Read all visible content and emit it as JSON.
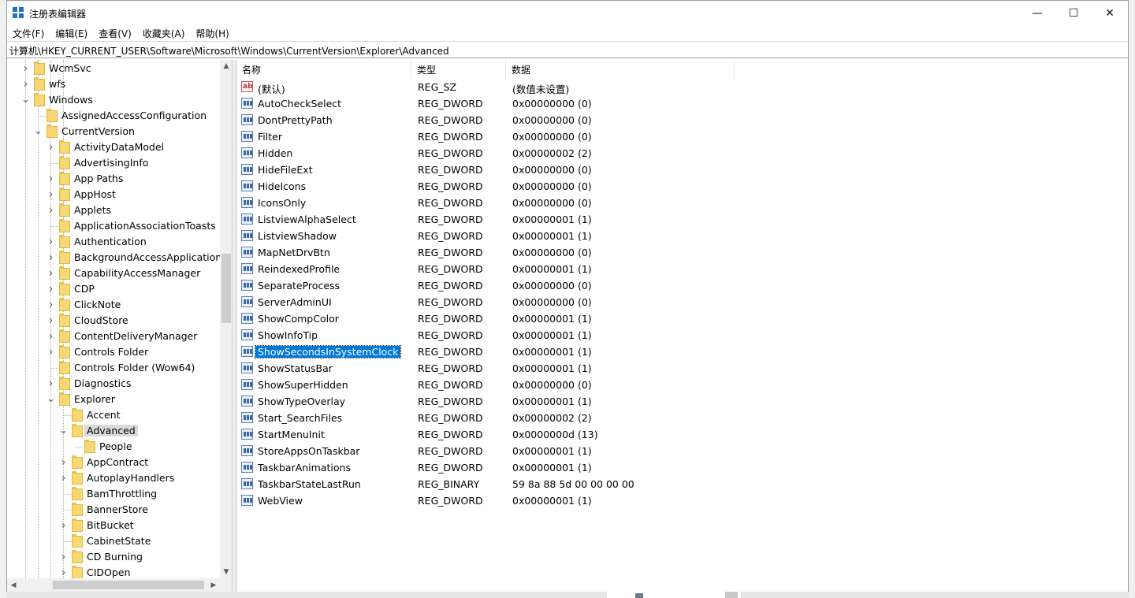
{
  "window": {
    "title": "注册表编辑器",
    "minimize_glyph": "—",
    "maximize_glyph": "☐",
    "close_glyph": "✕"
  },
  "menu": [
    {
      "label": "文件(F)",
      "name": "menu-file"
    },
    {
      "label": "编辑(E)",
      "name": "menu-edit"
    },
    {
      "label": "查看(V)",
      "name": "menu-view"
    },
    {
      "label": "收藏夹(A)",
      "name": "menu-favorites"
    },
    {
      "label": "帮助(H)",
      "name": "menu-help"
    }
  ],
  "address": "计算机\\HKEY_CURRENT_USER\\Software\\Microsoft\\Windows\\CurrentVersion\\Explorer\\Advanced",
  "tree": [
    {
      "label": "WcmSvc",
      "level": 0,
      "expander": "collapsed"
    },
    {
      "label": "wfs",
      "level": 0,
      "expander": "collapsed"
    },
    {
      "label": "Windows",
      "level": 0,
      "expander": "expanded"
    },
    {
      "label": "AssignedAccessConfiguration",
      "level": 1,
      "expander": "none"
    },
    {
      "label": "CurrentVersion",
      "level": 1,
      "expander": "expanded"
    },
    {
      "label": "ActivityDataModel",
      "level": 2,
      "expander": "collapsed"
    },
    {
      "label": "AdvertisingInfo",
      "level": 2,
      "expander": "none"
    },
    {
      "label": "App Paths",
      "level": 2,
      "expander": "collapsed"
    },
    {
      "label": "AppHost",
      "level": 2,
      "expander": "collapsed"
    },
    {
      "label": "Applets",
      "level": 2,
      "expander": "collapsed"
    },
    {
      "label": "ApplicationAssociationToasts",
      "level": 2,
      "expander": "none"
    },
    {
      "label": "Authentication",
      "level": 2,
      "expander": "collapsed"
    },
    {
      "label": "BackgroundAccessApplications",
      "level": 2,
      "expander": "collapsed"
    },
    {
      "label": "CapabilityAccessManager",
      "level": 2,
      "expander": "collapsed"
    },
    {
      "label": "CDP",
      "level": 2,
      "expander": "collapsed"
    },
    {
      "label": "ClickNote",
      "level": 2,
      "expander": "collapsed"
    },
    {
      "label": "CloudStore",
      "level": 2,
      "expander": "collapsed"
    },
    {
      "label": "ContentDeliveryManager",
      "level": 2,
      "expander": "collapsed"
    },
    {
      "label": "Controls Folder",
      "level": 2,
      "expander": "collapsed"
    },
    {
      "label": "Controls Folder (Wow64)",
      "level": 2,
      "expander": "none"
    },
    {
      "label": "Diagnostics",
      "level": 2,
      "expander": "collapsed"
    },
    {
      "label": "Explorer",
      "level": 2,
      "expander": "expanded"
    },
    {
      "label": "Accent",
      "level": 3,
      "expander": "none"
    },
    {
      "label": "Advanced",
      "level": 3,
      "expander": "expanded",
      "selected": true
    },
    {
      "label": "People",
      "level": 4,
      "expander": "none"
    },
    {
      "label": "AppContract",
      "level": 3,
      "expander": "collapsed"
    },
    {
      "label": "AutoplayHandlers",
      "level": 3,
      "expander": "collapsed"
    },
    {
      "label": "BamThrottling",
      "level": 3,
      "expander": "none"
    },
    {
      "label": "BannerStore",
      "level": 3,
      "expander": "none"
    },
    {
      "label": "BitBucket",
      "level": 3,
      "expander": "collapsed"
    },
    {
      "label": "CabinetState",
      "level": 3,
      "expander": "none"
    },
    {
      "label": "CD Burning",
      "level": 3,
      "expander": "collapsed"
    },
    {
      "label": "CIDOpen",
      "level": 3,
      "expander": "collapsed"
    }
  ],
  "columns": {
    "name": "名称",
    "type": "类型",
    "data": "数据"
  },
  "values": [
    {
      "name": "(默认)",
      "type": "REG_SZ",
      "data": "(数值未设置)",
      "icon": "string-value-icon"
    },
    {
      "name": "AutoCheckSelect",
      "type": "REG_DWORD",
      "data": "0x00000000 (0)",
      "icon": "binary-value-icon"
    },
    {
      "name": "DontPrettyPath",
      "type": "REG_DWORD",
      "data": "0x00000000 (0)",
      "icon": "binary-value-icon"
    },
    {
      "name": "Filter",
      "type": "REG_DWORD",
      "data": "0x00000000 (0)",
      "icon": "binary-value-icon"
    },
    {
      "name": "Hidden",
      "type": "REG_DWORD",
      "data": "0x00000002 (2)",
      "icon": "binary-value-icon"
    },
    {
      "name": "HideFileExt",
      "type": "REG_DWORD",
      "data": "0x00000000 (0)",
      "icon": "binary-value-icon"
    },
    {
      "name": "HideIcons",
      "type": "REG_DWORD",
      "data": "0x00000000 (0)",
      "icon": "binary-value-icon"
    },
    {
      "name": "IconsOnly",
      "type": "REG_DWORD",
      "data": "0x00000000 (0)",
      "icon": "binary-value-icon"
    },
    {
      "name": "ListviewAlphaSelect",
      "type": "REG_DWORD",
      "data": "0x00000001 (1)",
      "icon": "binary-value-icon"
    },
    {
      "name": "ListviewShadow",
      "type": "REG_DWORD",
      "data": "0x00000001 (1)",
      "icon": "binary-value-icon"
    },
    {
      "name": "MapNetDrvBtn",
      "type": "REG_DWORD",
      "data": "0x00000000 (0)",
      "icon": "binary-value-icon"
    },
    {
      "name": "ReindexedProfile",
      "type": "REG_DWORD",
      "data": "0x00000001 (1)",
      "icon": "binary-value-icon"
    },
    {
      "name": "SeparateProcess",
      "type": "REG_DWORD",
      "data": "0x00000000 (0)",
      "icon": "binary-value-icon"
    },
    {
      "name": "ServerAdminUI",
      "type": "REG_DWORD",
      "data": "0x00000000 (0)",
      "icon": "binary-value-icon"
    },
    {
      "name": "ShowCompColor",
      "type": "REG_DWORD",
      "data": "0x00000001 (1)",
      "icon": "binary-value-icon"
    },
    {
      "name": "ShowInfoTip",
      "type": "REG_DWORD",
      "data": "0x00000001 (1)",
      "icon": "binary-value-icon"
    },
    {
      "name": "ShowSecondsInSystemClock",
      "type": "REG_DWORD",
      "data": "0x00000001 (1)",
      "icon": "binary-value-icon",
      "selected": true
    },
    {
      "name": "ShowStatusBar",
      "type": "REG_DWORD",
      "data": "0x00000001 (1)",
      "icon": "binary-value-icon"
    },
    {
      "name": "ShowSuperHidden",
      "type": "REG_DWORD",
      "data": "0x00000000 (0)",
      "icon": "binary-value-icon"
    },
    {
      "name": "ShowTypeOverlay",
      "type": "REG_DWORD",
      "data": "0x00000001 (1)",
      "icon": "binary-value-icon"
    },
    {
      "name": "Start_SearchFiles",
      "type": "REG_DWORD",
      "data": "0x00000002 (2)",
      "icon": "binary-value-icon"
    },
    {
      "name": "StartMenuInit",
      "type": "REG_DWORD",
      "data": "0x0000000d (13)",
      "icon": "binary-value-icon"
    },
    {
      "name": "StoreAppsOnTaskbar",
      "type": "REG_DWORD",
      "data": "0x00000001 (1)",
      "icon": "binary-value-icon"
    },
    {
      "name": "TaskbarAnimations",
      "type": "REG_DWORD",
      "data": "0x00000001 (1)",
      "icon": "binary-value-icon"
    },
    {
      "name": "TaskbarStateLastRun",
      "type": "REG_BINARY",
      "data": "59 8a 88 5d 00 00 00 00",
      "icon": "binary-value-icon"
    },
    {
      "name": "WebView",
      "type": "REG_DWORD",
      "data": "0x00000001 (1)",
      "icon": "binary-value-icon"
    }
  ],
  "colors": {
    "selection": "#0078d7",
    "tree_selection": "#d9d9d9",
    "folder": "#f8d775",
    "app_icon": "#1d73c9"
  }
}
